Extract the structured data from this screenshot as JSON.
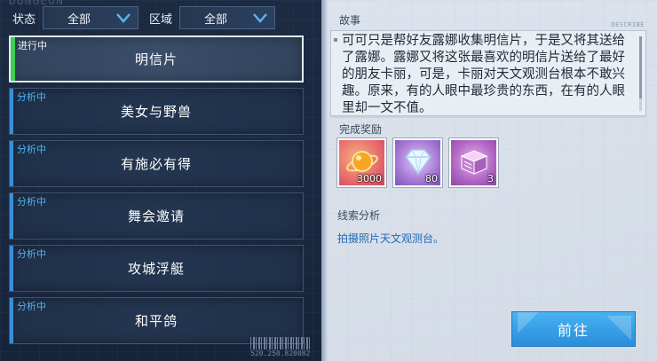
{
  "header": {
    "deco_title": "DUNGEON",
    "status_label": "状态",
    "status_value": "全部",
    "region_label": "区域",
    "region_value": "全部"
  },
  "quests": [
    {
      "status": "进行中",
      "title": "明信片",
      "active": true
    },
    {
      "status": "分析中",
      "title": "美女与野兽",
      "active": false
    },
    {
      "status": "分析中",
      "title": "有施必有得",
      "active": false
    },
    {
      "status": "分析中",
      "title": "舞会邀请",
      "active": false
    },
    {
      "status": "分析中",
      "title": "攻城浮艇",
      "active": false
    },
    {
      "status": "分析中",
      "title": "和平鸽",
      "active": false
    }
  ],
  "footer": {
    "serial": "520.250.820082"
  },
  "detail": {
    "story_label": "故事",
    "describe_tag": "DESCRIBE",
    "story_text": "可可只是帮好友露娜收集明信片，于是又将其送给了露娜。露娜又将这张最喜欢的明信片送给了最好的朋友卡丽，可是，卡丽对天文观测台根本不敢兴趣。原来，有的人眼中最珍贵的东西，在有的人眼里却一文不值。",
    "rewards_label": "完成奖励",
    "rewards": [
      {
        "icon": "gold-orb-icon",
        "count": "3000"
      },
      {
        "icon": "diamond-icon",
        "count": "80"
      },
      {
        "icon": "treasure-chest-icon",
        "count": "3"
      }
    ],
    "clue_label": "线索分析",
    "clue_text": "拍摄照片天文观测台。",
    "go_button": "前往"
  }
}
